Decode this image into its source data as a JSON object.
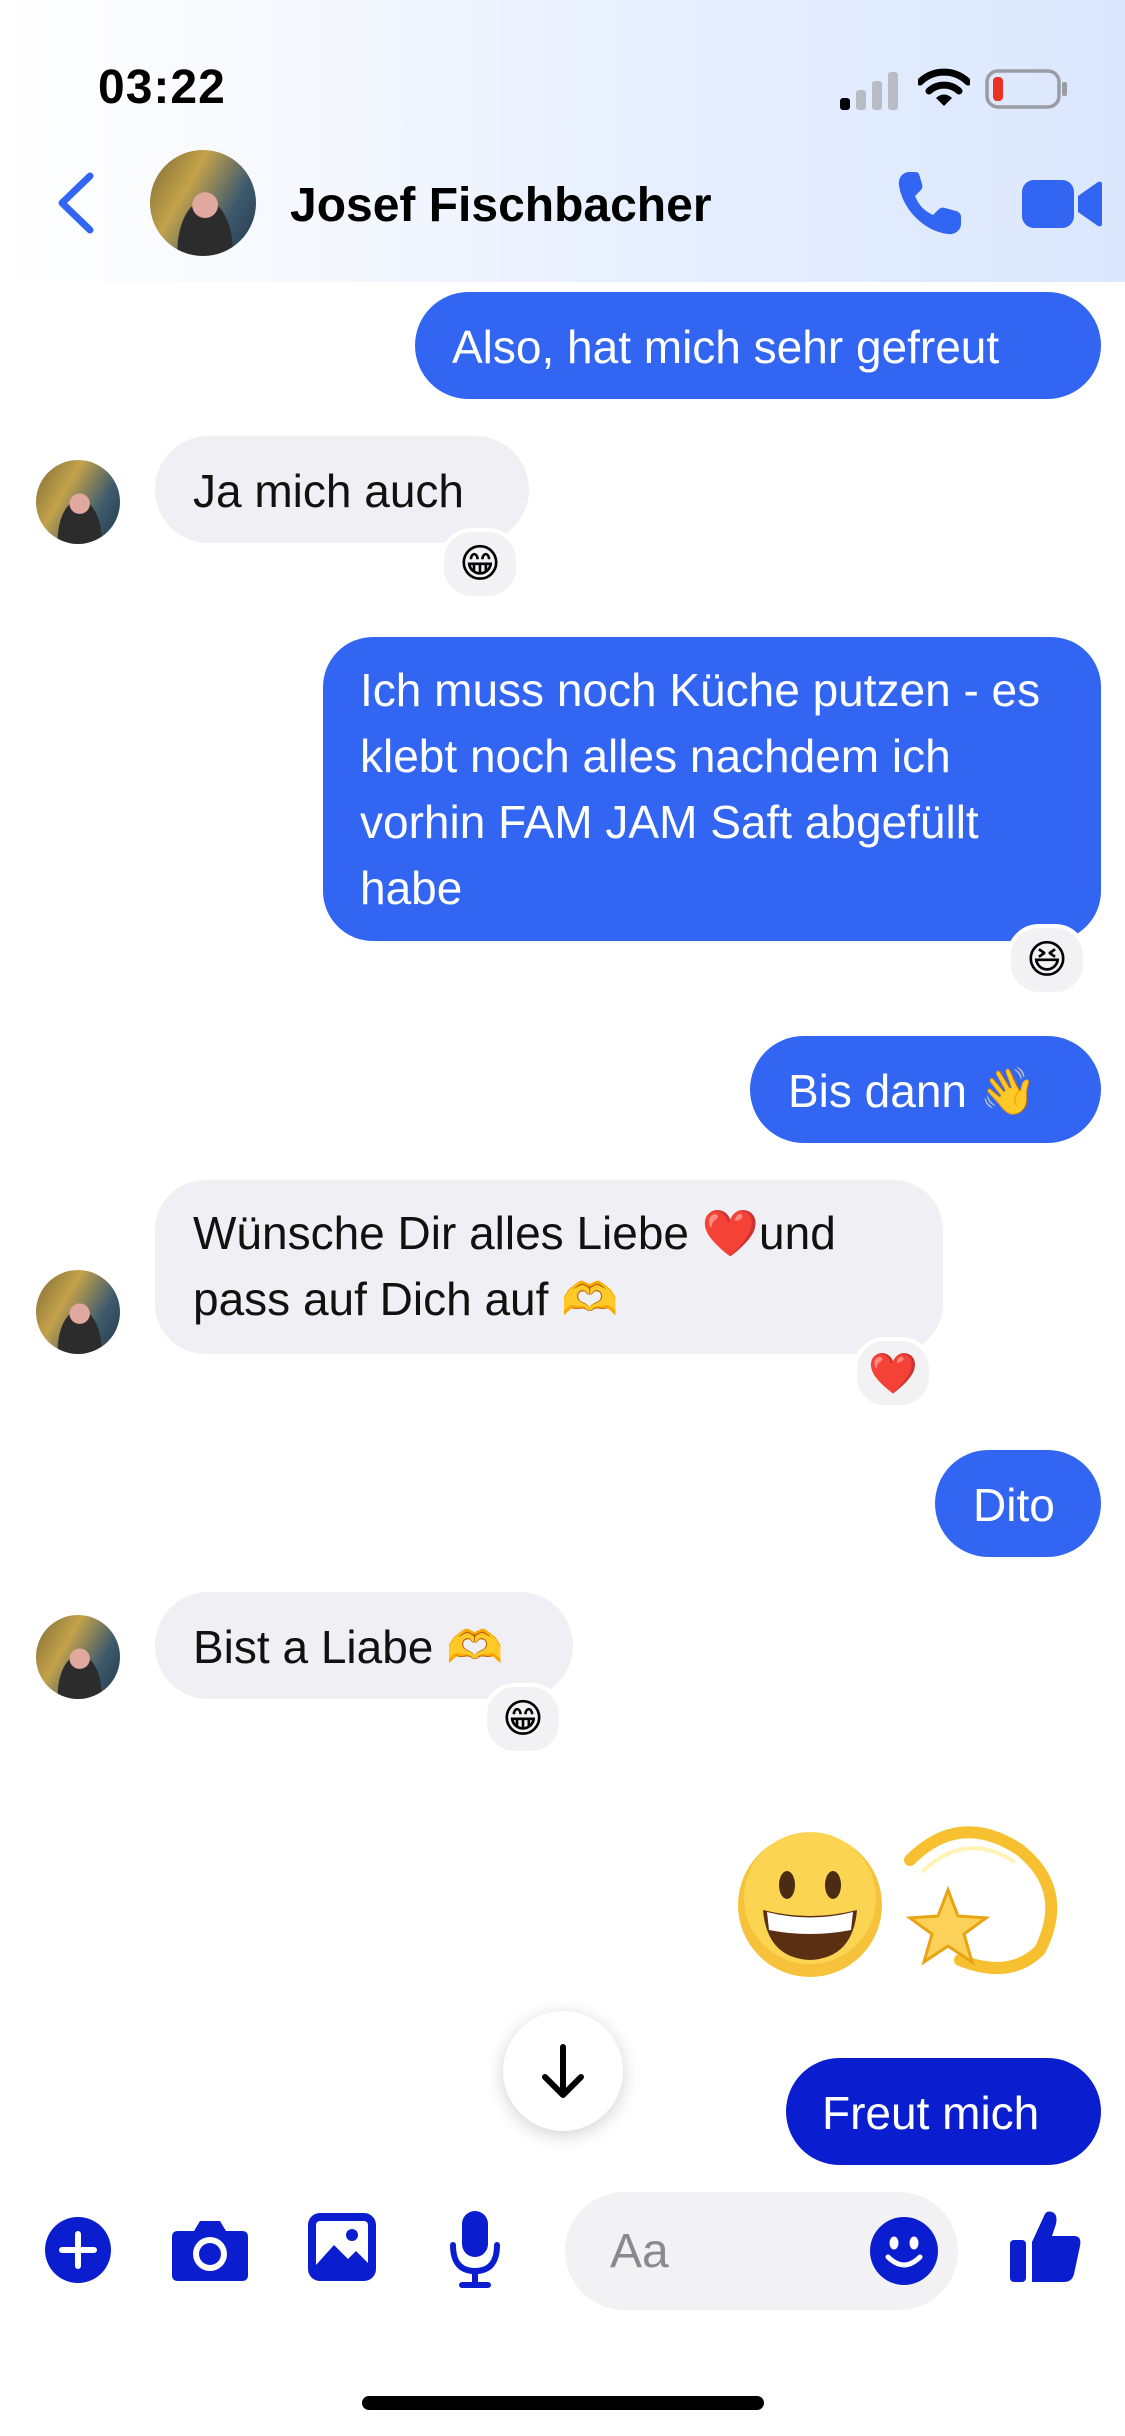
{
  "status_bar": {
    "time": "03:22"
  },
  "header": {
    "contact_name": "Josef Fischbacher"
  },
  "messages": [
    {
      "side": "out",
      "text": "Also, hat mich sehr gefreut"
    },
    {
      "side": "in",
      "text": "Ja mich auch",
      "reaction": "😁"
    },
    {
      "side": "out",
      "text": "Ich muss noch Küche putzen - es klebt noch alles nachdem ich vorhin FAM JAM Saft abgefüllt habe",
      "reaction": "😆"
    },
    {
      "side": "out",
      "text": "Bis dann 👋"
    },
    {
      "side": "in",
      "text": "Wünsche Dir alles Liebe ❤️und pass auf Dich auf 🫶",
      "reaction": "❤️"
    },
    {
      "side": "out",
      "text": "Dito"
    },
    {
      "side": "in",
      "text": "Bist a Liabe 🫶",
      "reaction": "😁"
    },
    {
      "side": "out",
      "emojis": [
        "😁",
        "💫"
      ]
    },
    {
      "side": "out",
      "text": "Freut mich"
    }
  ],
  "composer": {
    "placeholder": "Aa"
  },
  "icons": {
    "back": "chevron-left-icon",
    "phone": "phone-icon",
    "video": "video-camera-icon",
    "plus": "plus-icon",
    "camera": "camera-icon",
    "gallery": "image-icon",
    "mic": "microphone-icon",
    "emoji": "smiley-icon",
    "like": "thumbs-up-icon",
    "scroll_down": "arrow-down-icon"
  },
  "colors": {
    "accent": "#3165f2",
    "accent_dark": "#0a1ecf",
    "incoming_bubble": "#f0f0f4"
  }
}
